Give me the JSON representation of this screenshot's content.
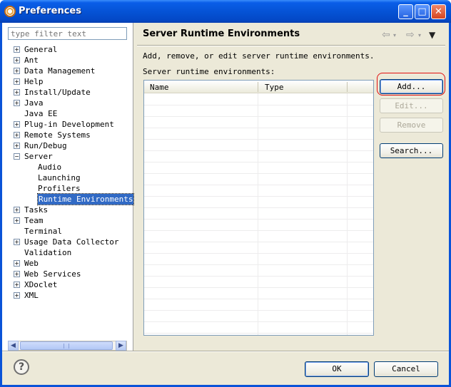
{
  "window": {
    "title": "Preferences"
  },
  "filter": {
    "placeholder": "type filter text"
  },
  "tree": {
    "items": [
      {
        "label": "General",
        "level": 0,
        "expander": "+"
      },
      {
        "label": "Ant",
        "level": 0,
        "expander": "+"
      },
      {
        "label": "Data Management",
        "level": 0,
        "expander": "+"
      },
      {
        "label": "Help",
        "level": 0,
        "expander": "+"
      },
      {
        "label": "Install/Update",
        "level": 0,
        "expander": "+"
      },
      {
        "label": "Java",
        "level": 0,
        "expander": "+"
      },
      {
        "label": "Java EE",
        "level": 0,
        "expander": ""
      },
      {
        "label": "Plug-in Development",
        "level": 0,
        "expander": "+"
      },
      {
        "label": "Remote Systems",
        "level": 0,
        "expander": "+"
      },
      {
        "label": "Run/Debug",
        "level": 0,
        "expander": "+"
      },
      {
        "label": "Server",
        "level": 0,
        "expander": "-"
      },
      {
        "label": "Audio",
        "level": 1,
        "expander": ""
      },
      {
        "label": "Launching",
        "level": 1,
        "expander": ""
      },
      {
        "label": "Profilers",
        "level": 1,
        "expander": ""
      },
      {
        "label": "Runtime Environments",
        "level": 1,
        "expander": "",
        "selected": true
      },
      {
        "label": "Tasks",
        "level": 0,
        "expander": "+"
      },
      {
        "label": "Team",
        "level": 0,
        "expander": "+"
      },
      {
        "label": "Terminal",
        "level": 0,
        "expander": ""
      },
      {
        "label": "Usage Data Collector",
        "level": 0,
        "expander": "+"
      },
      {
        "label": "Validation",
        "level": 0,
        "expander": ""
      },
      {
        "label": "Web",
        "level": 0,
        "expander": "+"
      },
      {
        "label": "Web Services",
        "level": 0,
        "expander": "+"
      },
      {
        "label": "XDoclet",
        "level": 0,
        "expander": "+"
      },
      {
        "label": "XML",
        "level": 0,
        "expander": "+"
      }
    ]
  },
  "page": {
    "title": "Server Runtime Environments",
    "description": "Add, remove, or edit server runtime environments.",
    "list_label": "Server runtime environments:",
    "columns": [
      "Name",
      "Type"
    ]
  },
  "buttons": {
    "add": "Add...",
    "edit": "Edit...",
    "remove": "Remove",
    "search": "Search..."
  },
  "footer": {
    "ok": "OK",
    "cancel": "Cancel",
    "help": "?"
  },
  "icons": {
    "back": "back-arrow-icon",
    "forward": "forward-arrow-icon",
    "menu": "view-menu-icon"
  },
  "colors": {
    "selection": "#316ac5",
    "highlight_ring": "#e01010",
    "titlebar": "#0553d6"
  }
}
